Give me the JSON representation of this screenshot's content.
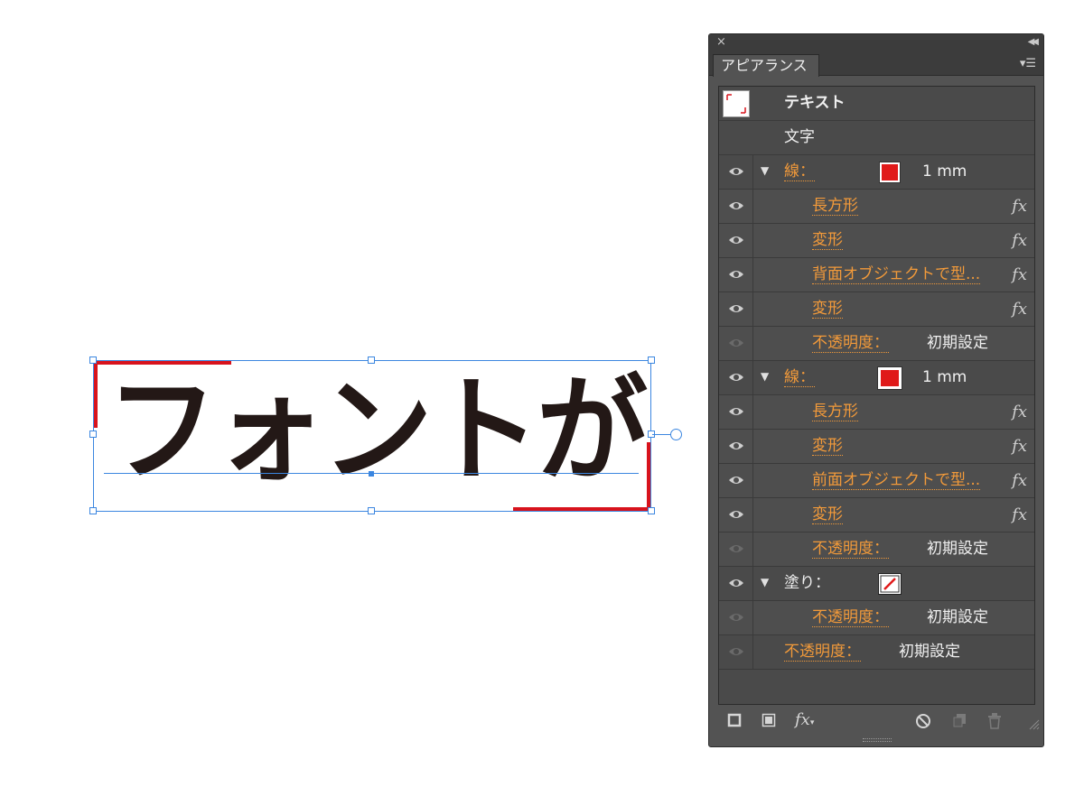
{
  "artboard": {
    "text": "フォントが",
    "colors": {
      "selection": "#3b86e0",
      "stroke_red": "#d8131c",
      "text": "#231816"
    }
  },
  "panel": {
    "tab_title": "アピアランス",
    "header": {
      "label": "テキスト"
    },
    "char_row": {
      "label": "文字"
    },
    "stroke1": {
      "label": "線：",
      "value": "1 mm",
      "effects": [
        {
          "label": "長方形",
          "fx": "fx"
        },
        {
          "label": "変形",
          "fx": "fx"
        },
        {
          "label": "背面オブジェクトで型...",
          "fx": "fx"
        },
        {
          "label": "変形",
          "fx": "fx"
        }
      ],
      "opacity": {
        "label": "不透明度：",
        "value": "初期設定"
      }
    },
    "stroke2": {
      "label": "線：",
      "value": "1 mm",
      "effects": [
        {
          "label": "長方形",
          "fx": "fx"
        },
        {
          "label": "変形",
          "fx": "fx"
        },
        {
          "label": "前面オブジェクトで型...",
          "fx": "fx"
        },
        {
          "label": "変形",
          "fx": "fx"
        }
      ],
      "opacity": {
        "label": "不透明度：",
        "value": "初期設定"
      }
    },
    "fill": {
      "label": "塗り：",
      "opacity": {
        "label": "不透明度：",
        "value": "初期設定"
      }
    },
    "opacity": {
      "label": "不透明度：",
      "value": "初期設定"
    },
    "colors": {
      "label_orange": "#f29a3a",
      "swatch_red": "#e01a1a",
      "panel_bg": "#535353"
    },
    "icons": [
      "close-icon",
      "collapse-icon",
      "panel-menu-icon",
      "eye-icon",
      "disclosure-triangle-icon",
      "fx-icon",
      "add-stroke-icon",
      "add-fill-icon",
      "add-effect-icon",
      "clear-appearance-icon",
      "duplicate-item-icon",
      "delete-item-icon"
    ]
  }
}
